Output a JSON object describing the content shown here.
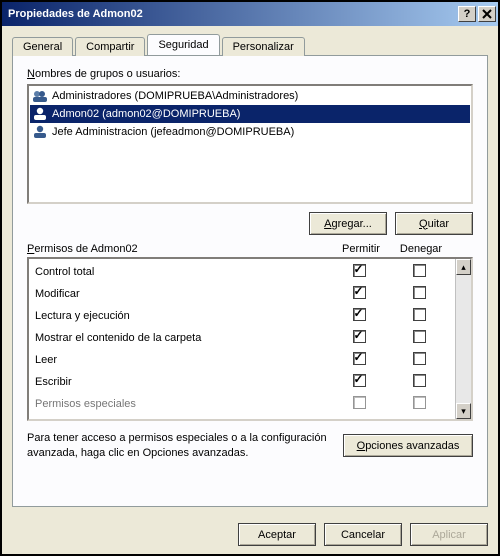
{
  "window": {
    "title": "Propiedades de Admon02"
  },
  "tabs": {
    "items": [
      "General",
      "Compartir",
      "Seguridad",
      "Personalizar"
    ],
    "activeIndex": 2
  },
  "usersSection": {
    "label": "Nombres de grupos o usuarios:",
    "items": [
      {
        "display": "Administradores (DOMIPRUEBA\\Administradores)",
        "selected": false
      },
      {
        "display": "Admon02 (admon02@DOMIPRUEBA)",
        "selected": true
      },
      {
        "display": "Jefe Administracion (jefeadmon@DOMIPRUEBA)",
        "selected": false
      }
    ],
    "addBtn": "Agregar...",
    "removeBtn": "Quitar"
  },
  "permissions": {
    "headerFor": "Permisos de Admon02",
    "colAllow": "Permitir",
    "colDeny": "Denegar",
    "rows": [
      {
        "name": "Control total",
        "allow": true,
        "deny": false
      },
      {
        "name": "Modificar",
        "allow": true,
        "deny": false
      },
      {
        "name": "Lectura y ejecución",
        "allow": true,
        "deny": false
      },
      {
        "name": "Mostrar el contenido de la carpeta",
        "allow": true,
        "deny": false
      },
      {
        "name": "Leer",
        "allow": true,
        "deny": false
      },
      {
        "name": "Escribir",
        "allow": true,
        "deny": false
      },
      {
        "name": "Permisos especiales",
        "allow": false,
        "deny": false
      }
    ]
  },
  "note": "Para tener acceso a permisos especiales o a la configuración avanzada, haga clic en Opciones avanzadas.",
  "advancedBtn": "Opciones avanzadas",
  "footer": {
    "ok": "Aceptar",
    "cancel": "Cancelar",
    "apply": "Aplicar"
  }
}
